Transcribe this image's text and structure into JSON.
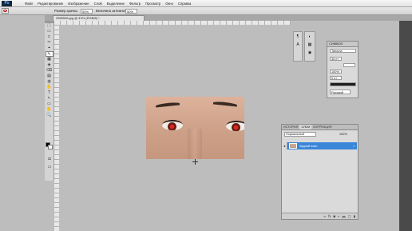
{
  "app": {
    "logo": "Ps"
  },
  "menu": [
    "Файл",
    "Редактирование",
    "Изображение",
    "Слой",
    "Выделение",
    "Фильтр",
    "Просмотр",
    "Окно",
    "Справка"
  ],
  "options": {
    "brush_label": "Размер зрачка:",
    "brush_value": "50%",
    "darken_label": "Величина затемнения:",
    "darken_value": "50%"
  },
  "document_tab": "2569536.jpg @ 43% (RGB/8) *",
  "tools": [
    "⬚",
    "▭",
    "⊂",
    "✂",
    "⌖",
    "✎",
    "▦",
    "◈",
    "⌫",
    "▤",
    "◍",
    "✋",
    "T",
    "↖",
    "▭",
    "✋",
    "🔍"
  ],
  "character_panel": {
    "title": "СИМВОЛ",
    "font": "Tahoma",
    "size": "36 пт",
    "leading": "100%",
    "tracking": "0 пт",
    "language": "Русский"
  },
  "layers_panel": {
    "tabs": [
      "ИСТОРИЯ",
      "СЛОИ",
      "КОРРЕКЦИЯ"
    ],
    "blend_mode": "Нормальный",
    "opacity_label": "Непрозр.:",
    "opacity_value": "100%",
    "fill_label": "Заливка:",
    "fill_value": "100%",
    "layer_name": "Задний план",
    "footer_icons": [
      "link-icon",
      "fx-icon",
      "mask-icon",
      "adjustment-icon",
      "folder-icon",
      "new-layer-icon",
      "trash-icon"
    ]
  },
  "colors": {
    "workspace": "#bdbdbd",
    "selected_layer": "#3a86d9",
    "red_eye": "#d42b1c"
  }
}
